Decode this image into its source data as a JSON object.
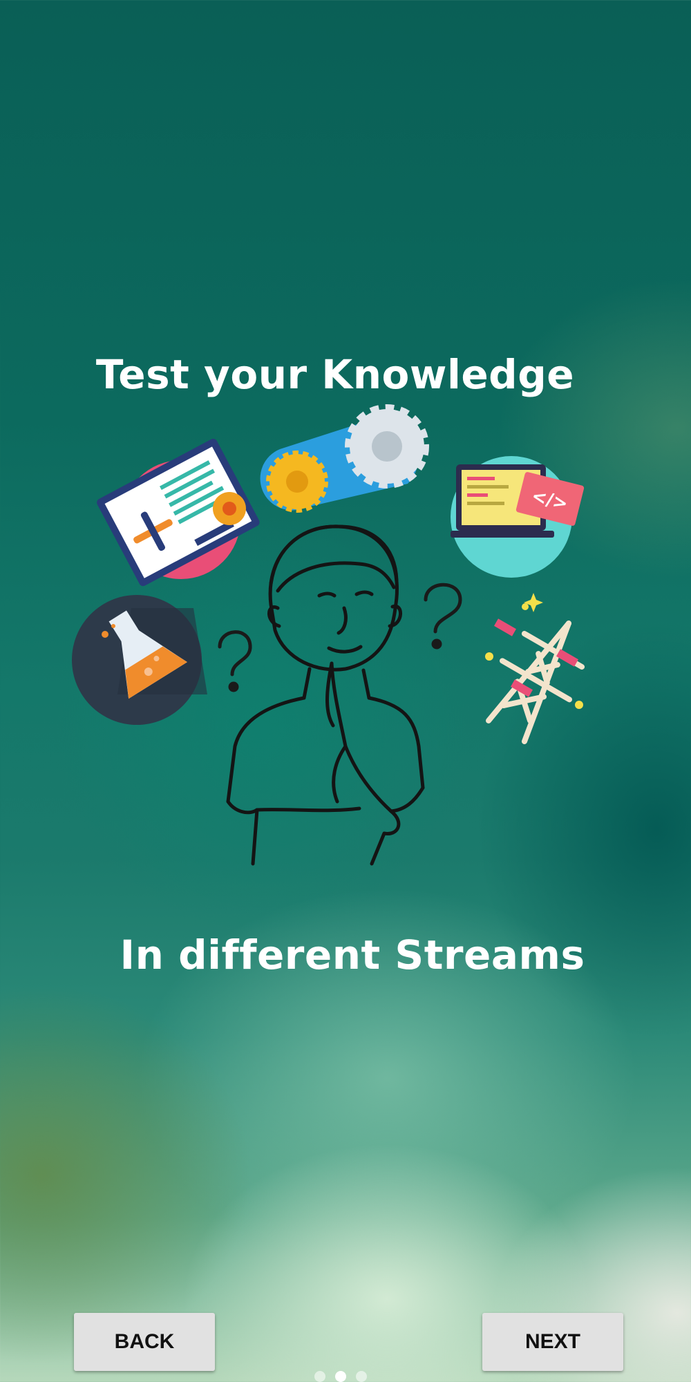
{
  "intro": {
    "title": "Test your Knowledge",
    "subtitle": "In different Streams"
  },
  "illustration": {
    "icons": [
      "clipboard-tools-icon",
      "gears-icon",
      "code-laptop-icon",
      "science-flask-icon",
      "transmission-tower-icon",
      "question-mark-icon",
      "thinking-person"
    ]
  },
  "navigation": {
    "back_label": "BACK",
    "next_label": "NEXT",
    "page_count": 3,
    "current_page": 2
  },
  "colors": {
    "background_top": "#0a5f56",
    "text": "#ffffff",
    "button_bg": "#e1e1e1",
    "button_text": "#111111"
  }
}
